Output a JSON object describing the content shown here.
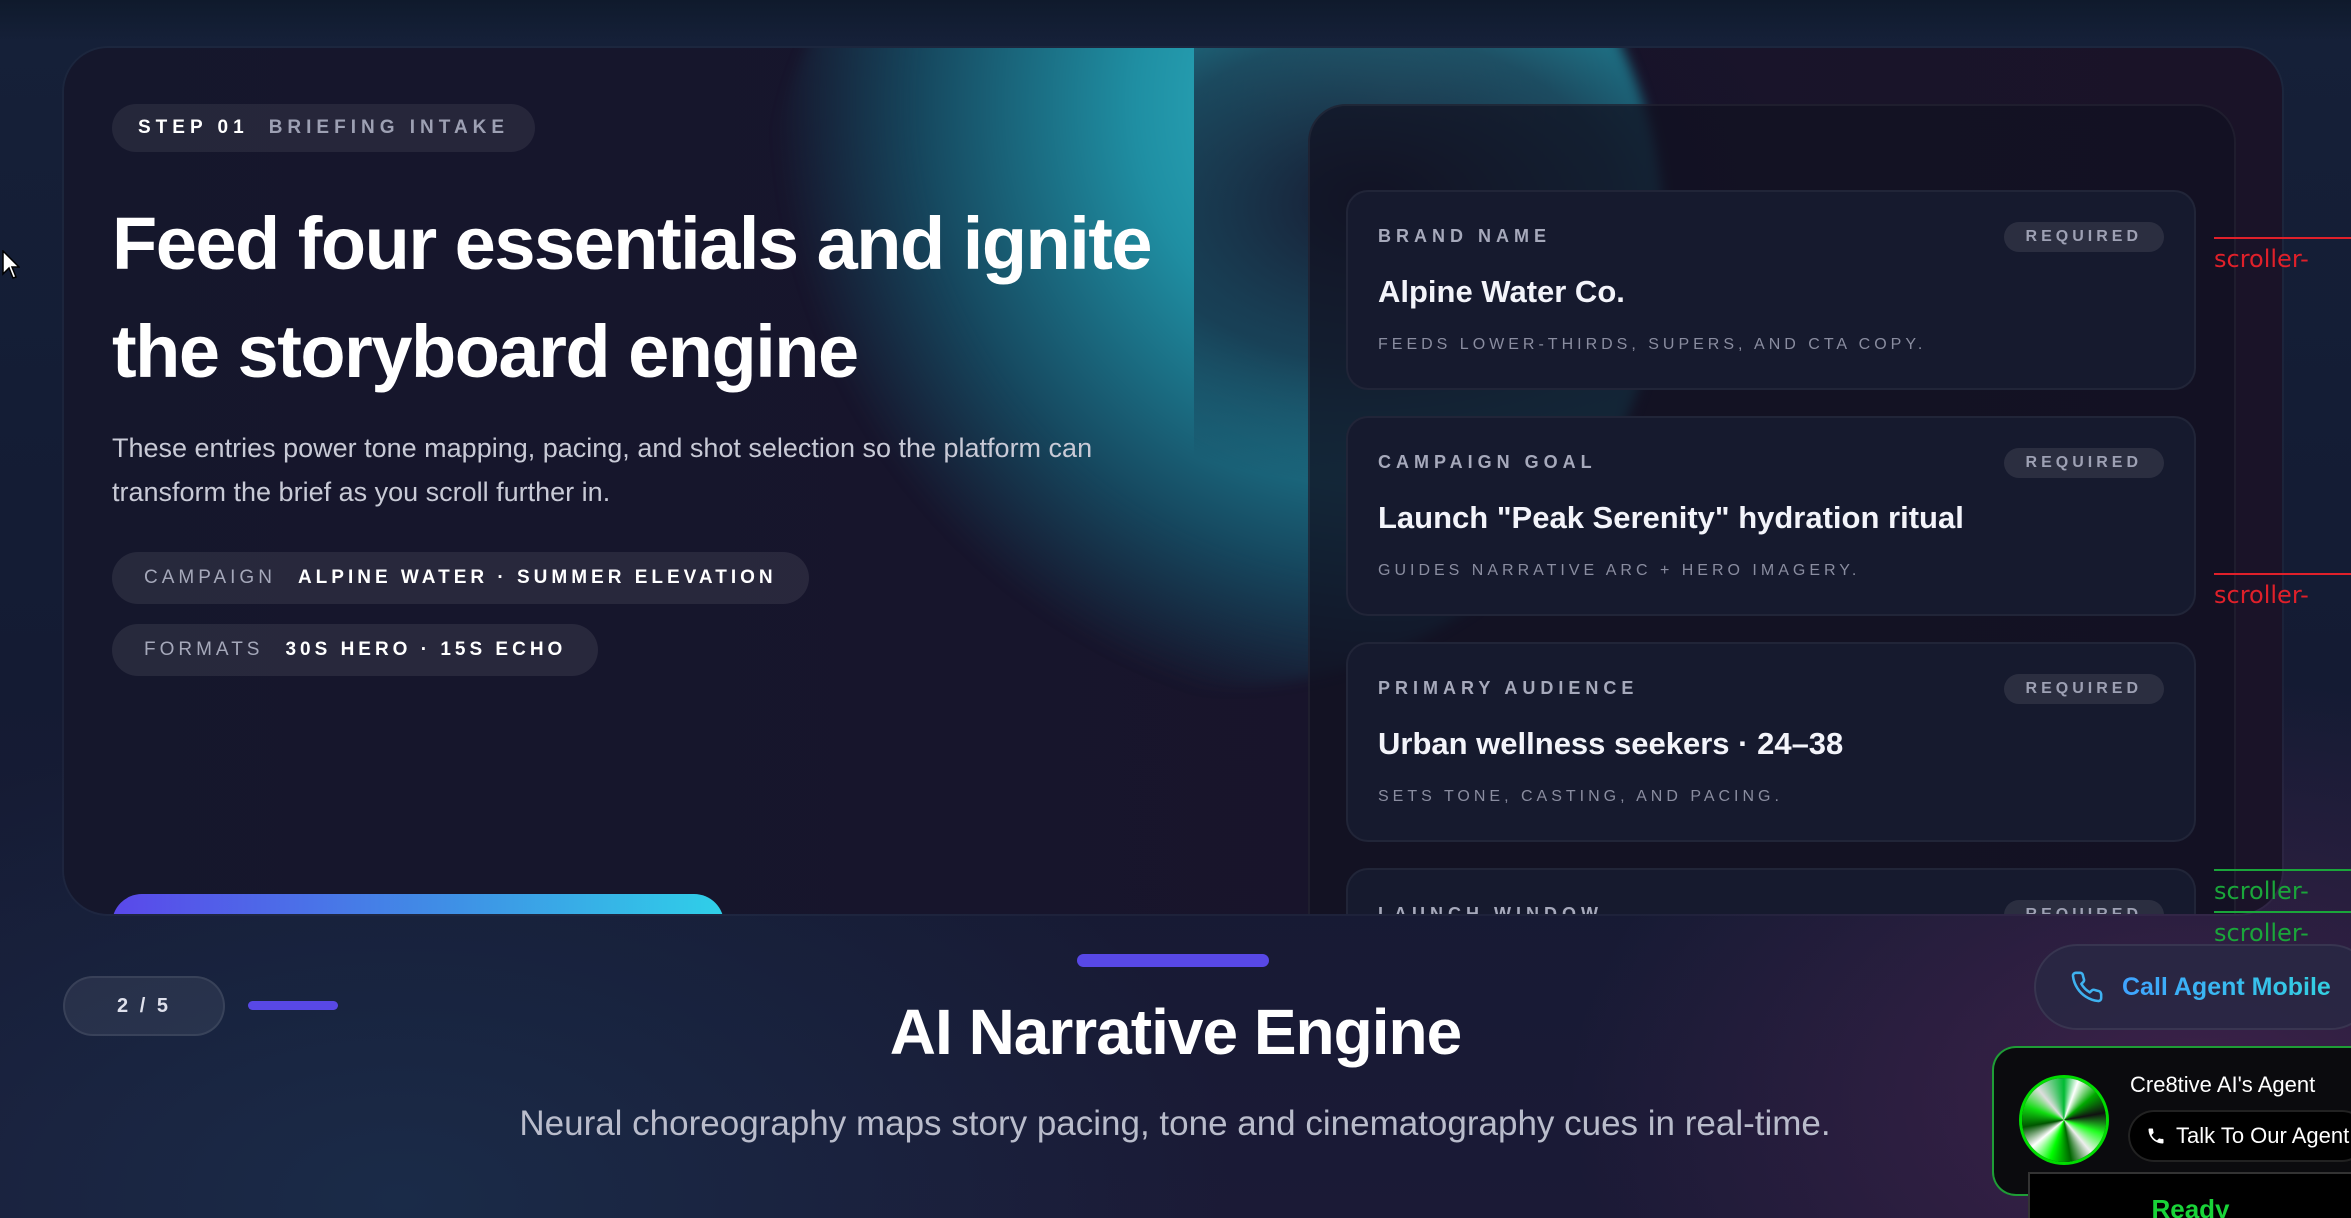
{
  "hero": {
    "step_number": "STEP 01",
    "step_label": "BRIEFING INTAKE",
    "headline_line1": "Feed four essentials and ignite",
    "headline_line2": "the storyboard engine",
    "description": "These entries power tone mapping, pacing, and shot selection so the platform can transform the brief as you scroll further in.",
    "campaign_key": "CAMPAIGN",
    "campaign_value": "ALPINE WATER · SUMMER ELEVATION",
    "formats_key": "FORMATS",
    "formats_value": "30S HERO · 15S ECHO"
  },
  "fields": [
    {
      "label": "BRAND NAME",
      "badge": "REQUIRED",
      "value": "Alpine Water Co.",
      "hint": "FEEDS LOWER-THIRDS, SUPERS, AND CTA COPY."
    },
    {
      "label": "CAMPAIGN GOAL",
      "badge": "REQUIRED",
      "value": "Launch \"Peak Serenity\" hydration ritual",
      "hint": "GUIDES NARRATIVE ARC + HERO IMAGERY."
    },
    {
      "label": "PRIMARY AUDIENCE",
      "badge": "REQUIRED",
      "value": "Urban wellness seekers · 24–38",
      "hint": "SETS TONE, CASTING, AND PACING."
    },
    {
      "label": "LAUNCH WINDOW",
      "badge": "REQUIRED",
      "value": "",
      "hint": ""
    }
  ],
  "markers": [
    "scroller-",
    "scroller-",
    "scroller-",
    "scroller-"
  ],
  "pager": {
    "counter": "2 / 5"
  },
  "section": {
    "title": "AI Narrative Engine",
    "subtitle": "Neural choreography maps story pacing, tone and cinematography cues in real-time."
  },
  "call_button": {
    "label": "Call Agent Mobile"
  },
  "agent": {
    "name": "Cre8tive AI's Agent",
    "talk_label": "Talk To Our Agent",
    "status": "Ready"
  },
  "colors": {
    "accent": "#5848e6",
    "cta_end": "#2fd0e8",
    "status_green": "#19d438"
  }
}
